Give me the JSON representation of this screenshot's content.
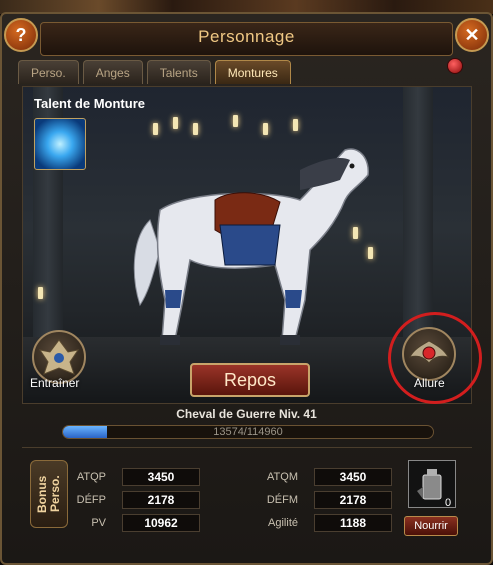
{
  "window": {
    "title": "Personnage"
  },
  "tabs": [
    {
      "label": "Perso.",
      "active": false
    },
    {
      "label": "Anges",
      "active": false
    },
    {
      "label": "Talents",
      "active": false
    },
    {
      "label": "Montures",
      "active": true
    }
  ],
  "talent": {
    "label": "Talent de Monture",
    "icon": "lightning-orb-icon"
  },
  "actions": {
    "train": "Entraîner",
    "rest": "Repos",
    "allure": "Allure"
  },
  "mount": {
    "name": "Cheval de Guerre Niv. 41",
    "xp_current": 13574,
    "xp_max": 114960,
    "xp_text": "13574/114960"
  },
  "bonus_label": "Bonus Perso.",
  "stats": {
    "left": [
      {
        "name": "ATQP",
        "value": "3450"
      },
      {
        "name": "DÉFP",
        "value": "2178"
      },
      {
        "name": "PV",
        "value": "10962"
      }
    ],
    "right": [
      {
        "name": "ATQM",
        "value": "3450"
      },
      {
        "name": "DÉFM",
        "value": "2178"
      },
      {
        "name": "Agilité",
        "value": "1188"
      }
    ]
  },
  "feed": {
    "item_icon": "feed-bottle-icon",
    "count": "0",
    "button": "Nourrir"
  },
  "colors": {
    "highlight_circle": "#d21e1e",
    "xp_bar": "#4a90e8",
    "title": "#f0c884"
  }
}
